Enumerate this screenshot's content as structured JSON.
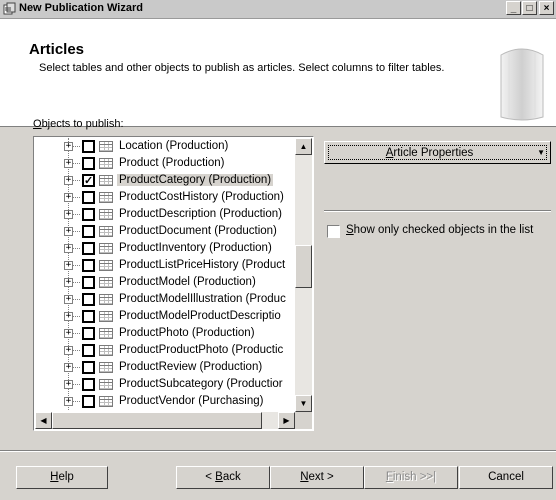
{
  "window": {
    "title": "New Publication Wizard",
    "controls": [
      "_",
      "□",
      "×"
    ]
  },
  "header": {
    "title": "Articles",
    "description": "Select tables and other objects to publish as articles. Select columns to filter tables."
  },
  "objects_label": {
    "accel": "O",
    "rest": "bjects to publish:"
  },
  "tree": {
    "items": [
      {
        "label": "Location (Production)",
        "checked": false
      },
      {
        "label": "Product (Production)",
        "checked": false
      },
      {
        "label": "ProductCategory (Production)",
        "checked": true,
        "selected": true
      },
      {
        "label": "ProductCostHistory (Production)",
        "checked": false
      },
      {
        "label": "ProductDescription (Production)",
        "checked": false
      },
      {
        "label": "ProductDocument (Production)",
        "checked": false
      },
      {
        "label": "ProductInventory (Production)",
        "checked": false
      },
      {
        "label": "ProductListPriceHistory (Product",
        "checked": false
      },
      {
        "label": "ProductModel (Production)",
        "checked": false
      },
      {
        "label": "ProductModelIllustration (Produc",
        "checked": false
      },
      {
        "label": "ProductModelProductDescriptio",
        "checked": false
      },
      {
        "label": "ProductPhoto (Production)",
        "checked": false
      },
      {
        "label": "ProductProductPhoto (Productic",
        "checked": false
      },
      {
        "label": "ProductReview (Production)",
        "checked": false
      },
      {
        "label": "ProductSubcategory (Productior",
        "checked": false
      },
      {
        "label": "ProductVendor (Purchasing)",
        "checked": false
      }
    ],
    "expander_glyph": "+",
    "check_glyph": "✓"
  },
  "article_properties": {
    "accel": "A",
    "rest": "rticle Properties",
    "arrow": "▼"
  },
  "show_only": {
    "accel": "S",
    "rest": "how only checked objects in the list",
    "checked": false
  },
  "buttons": {
    "help": {
      "accel": "H",
      "rest": "elp"
    },
    "back": {
      "pre": "< ",
      "accel": "B",
      "rest": "ack"
    },
    "next": {
      "accel": "N",
      "rest": "ext >"
    },
    "finish": {
      "accel": "F",
      "rest": "inish >>|",
      "disabled": true
    },
    "cancel": {
      "label": "Cancel"
    }
  },
  "scroll_arrows": {
    "up": "▲",
    "down": "▼",
    "left": "◀",
    "right": "▶"
  },
  "colors": {
    "face": "#d6d3ce",
    "selection": "#d6d3ce"
  }
}
